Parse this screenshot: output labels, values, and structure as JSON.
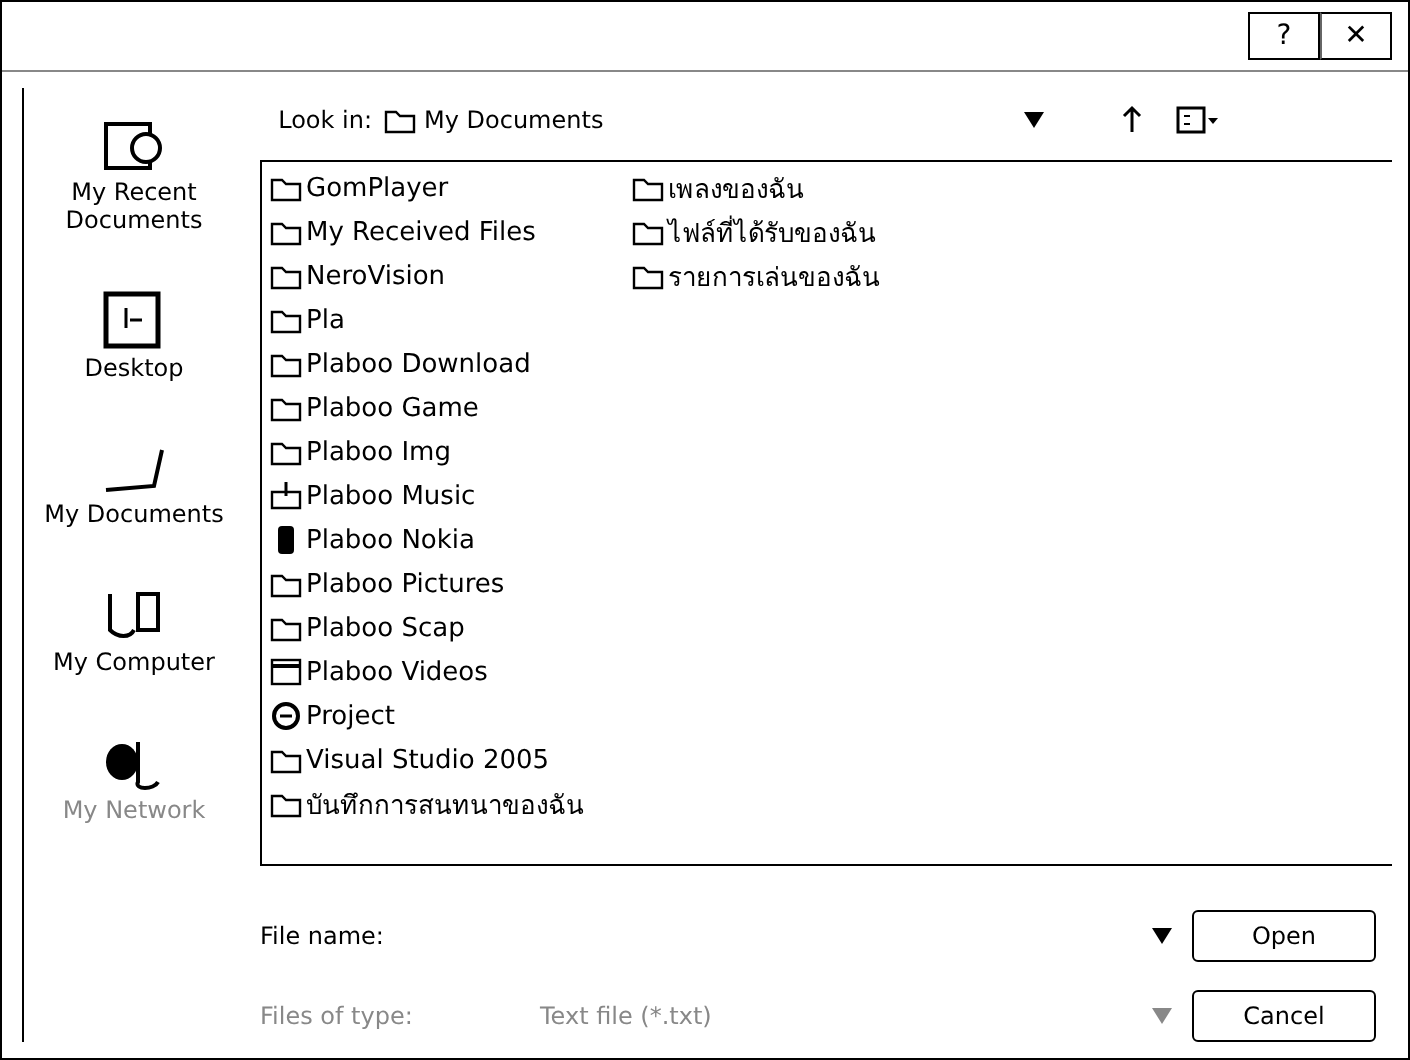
{
  "window": {
    "help_button": "?",
    "close_button": "✕"
  },
  "look_in": {
    "label": "Look in:",
    "value": "My Documents"
  },
  "places": [
    {
      "label": "My Recent Documents",
      "kind": "recent",
      "disabled": false
    },
    {
      "label": "Desktop",
      "kind": "desktop",
      "disabled": false
    },
    {
      "label": "My Documents",
      "kind": "documents",
      "disabled": false
    },
    {
      "label": "My Computer",
      "kind": "computer",
      "disabled": false
    },
    {
      "label": "My Network",
      "kind": "network",
      "disabled": true
    }
  ],
  "files": [
    {
      "name": "GomPlayer",
      "kind": "folder"
    },
    {
      "name": "My Received Files",
      "kind": "folder"
    },
    {
      "name": "NeroVision",
      "kind": "folder"
    },
    {
      "name": "Pla",
      "kind": "folder"
    },
    {
      "name": "Plaboo Download",
      "kind": "folder"
    },
    {
      "name": "Plaboo Game",
      "kind": "folder"
    },
    {
      "name": "Plaboo Img",
      "kind": "folder"
    },
    {
      "name": "Plaboo Music",
      "kind": "music"
    },
    {
      "name": "Plaboo Nokia",
      "kind": "phone"
    },
    {
      "name": "Plaboo Pictures",
      "kind": "folder"
    },
    {
      "name": "Plaboo Scap",
      "kind": "folder"
    },
    {
      "name": "Plaboo Videos",
      "kind": "video"
    },
    {
      "name": "Project",
      "kind": "globe"
    },
    {
      "name": "Visual Studio 2005",
      "kind": "folder"
    },
    {
      "name": "บันทึกการสนทนาของฉัน",
      "kind": "folder"
    },
    {
      "name": "เพลงของฉัน",
      "kind": "folder"
    },
    {
      "name": "ไฟล์ที่ได้รับของฉัน",
      "kind": "folder"
    },
    {
      "name": "รายการเล่นของฉัน",
      "kind": "folder"
    }
  ],
  "file_name": {
    "label": "File name:",
    "disabled": false
  },
  "file_type": {
    "label": "Files of type:",
    "value": "Text file (*.txt)",
    "disabled": true
  },
  "buttons": [
    {
      "label": "Open",
      "disabled": false
    },
    {
      "label": "Cancel",
      "disabled": false
    }
  ]
}
